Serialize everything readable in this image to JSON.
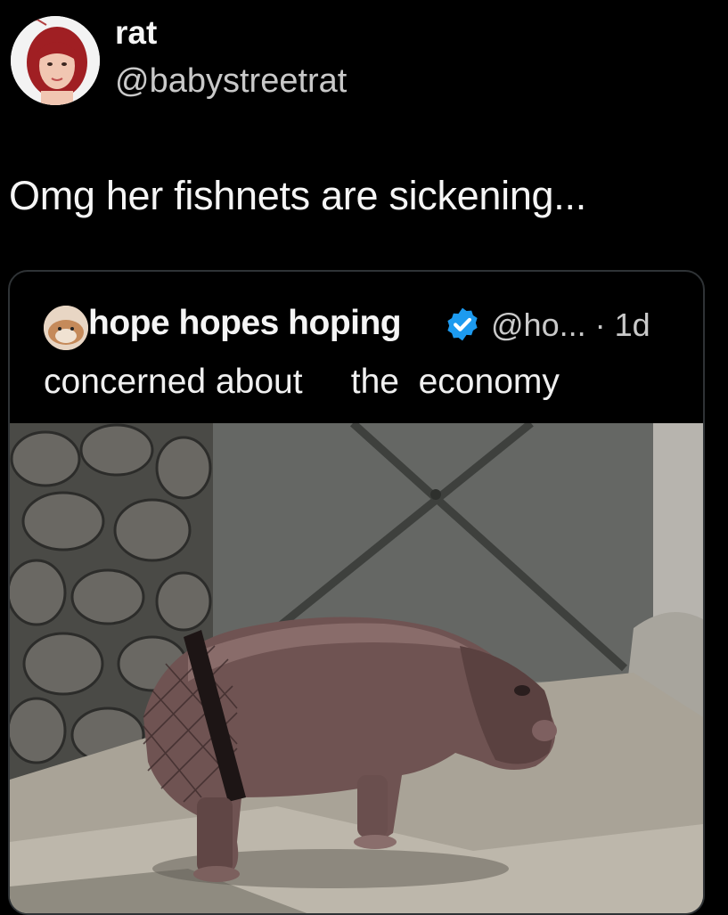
{
  "tweet": {
    "display_name": "rat",
    "handle": "@babystreetrat",
    "text": "Omg her fishnets are sickening..."
  },
  "quoted_tweet": {
    "display_name": "hope hopes hoping",
    "verified": true,
    "handle_time": "@ho... · 1d",
    "text": "concerned about     the  economy"
  },
  "icons": {
    "avatar": "user-photo-avatar",
    "quoted_avatar": "user-photo-avatar",
    "verified": "verified-badge-icon"
  },
  "colors": {
    "background": "#000000",
    "verified_blue": "#1d9bf0",
    "text_primary": "#f5f5f5",
    "text_secondary": "#c9c9c9"
  }
}
